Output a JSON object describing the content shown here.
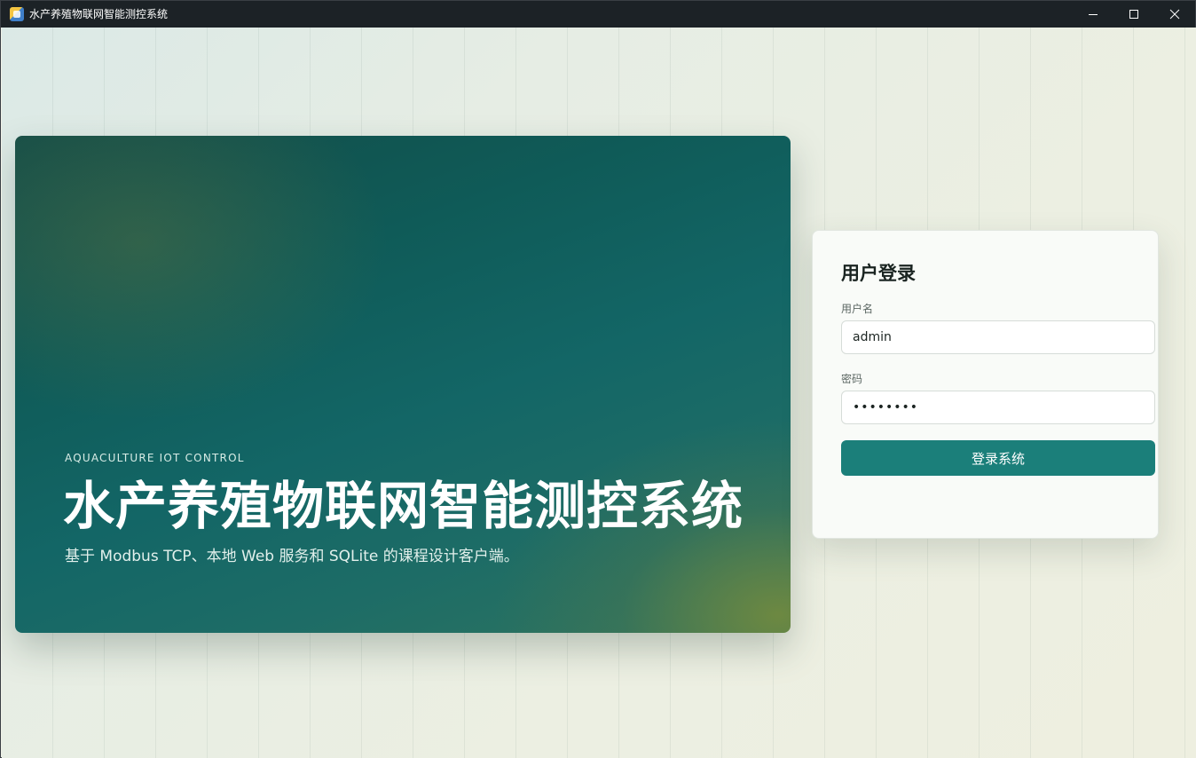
{
  "window": {
    "title": "水产养殖物联网智能测控系统"
  },
  "hero": {
    "eyebrow": "AQUACULTURE IOT CONTROL",
    "title": "水产养殖物联网智能测控系统",
    "subtitle": "基于 Modbus TCP、本地 Web 服务和 SQLite 的课程设计客户端。"
  },
  "login": {
    "title": "用户登录",
    "username_label": "用户名",
    "username_value": "admin",
    "password_label": "密码",
    "password_value": "admin123",
    "submit_label": "登录系统"
  },
  "colors": {
    "accent": "#1b7f7a",
    "hero_dark": "#0f5b58",
    "titlebar": "#1c2226"
  },
  "icons": {
    "app": "app-icon",
    "minimize": "minimize-icon",
    "maximize": "maximize-icon",
    "close": "close-icon"
  }
}
